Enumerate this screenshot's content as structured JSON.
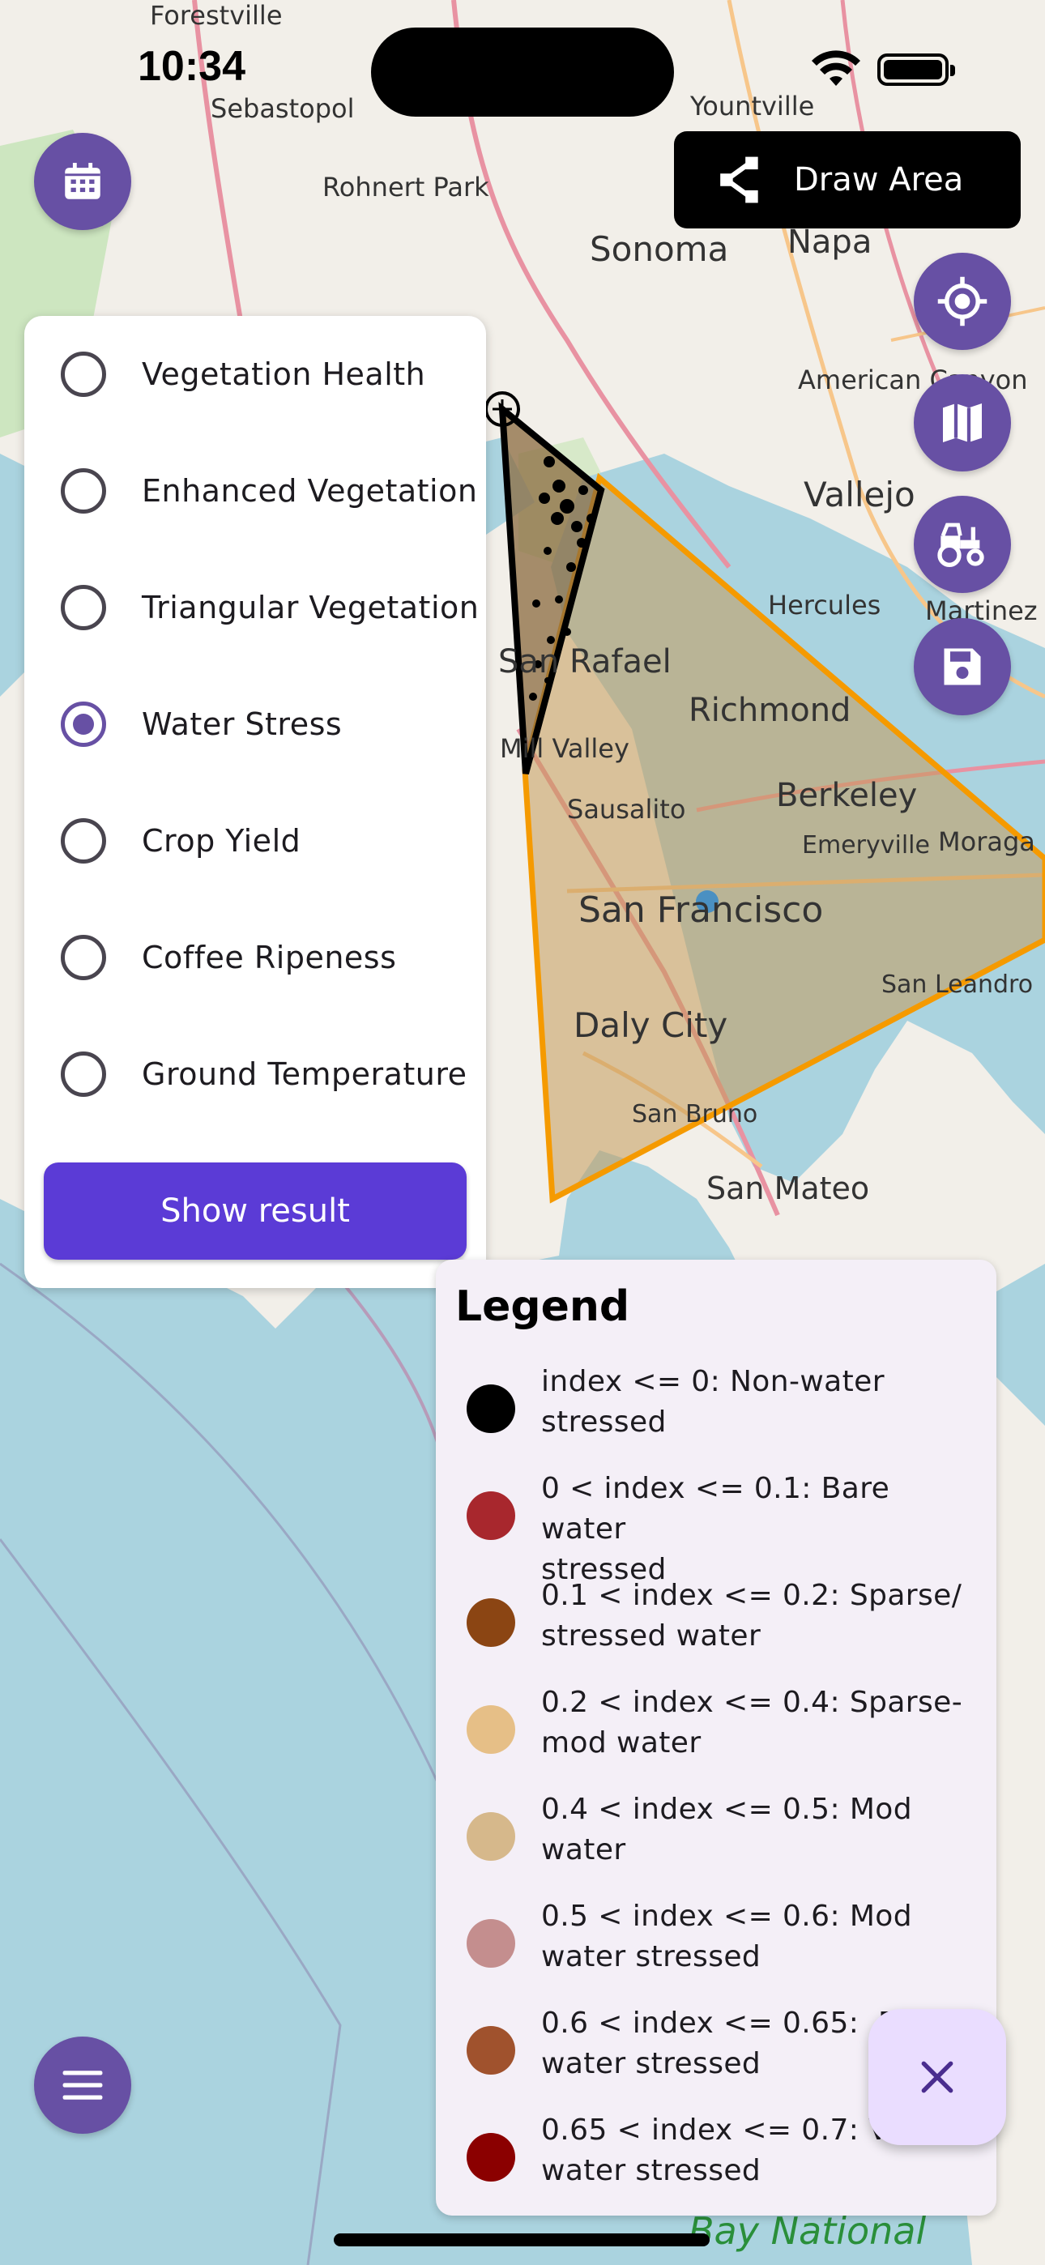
{
  "status_bar": {
    "time": "10:34"
  },
  "map": {
    "place_labels": [
      "Forestville",
      "Sebastopol",
      "Rohnert Park",
      "Sonoma",
      "Napa",
      "Yountville",
      "American Canyon",
      "Vallejo",
      "Hercules",
      "Martinez",
      "San Rafael",
      "Richmond",
      "Mill Valley",
      "Sausalito",
      "Berkeley",
      "Emeryville",
      "Moraga",
      "San Francisco",
      "San Leandro",
      "Daly City",
      "San Bruno",
      "San Mateo",
      "Bay National"
    ],
    "polygon_colors": {
      "black_area": "#000000",
      "orange_area": "#f59a00",
      "fill": "#a07d45"
    }
  },
  "toolbar": {
    "draw_area_label": "Draw Area",
    "calendar_icon": "calendar-icon",
    "locate_icon": "locate-icon",
    "map_icon": "map-icon",
    "tractor_icon": "tractor-icon",
    "save_icon": "save-icon",
    "menu_icon": "menu-icon"
  },
  "index_panel": {
    "options": [
      {
        "label": "Vegetation Health",
        "selected": false
      },
      {
        "label": "Enhanced Vegetation",
        "selected": false
      },
      {
        "label": "Triangular Vegetation",
        "selected": false
      },
      {
        "label": "Water Stress",
        "selected": true
      },
      {
        "label": "Crop Yield",
        "selected": false
      },
      {
        "label": "Coffee Ripeness",
        "selected": false
      },
      {
        "label": "Ground Temperature",
        "selected": false
      }
    ],
    "show_result_label": "Show result"
  },
  "legend": {
    "title": "Legend",
    "items": [
      {
        "color": "#000000",
        "text": "index <= 0: Non-water\nstressed"
      },
      {
        "color": "#a8272d",
        "text": "0 < index <= 0.1: Bare water\nstressed"
      },
      {
        "color": "#8b4513",
        "text": "0.1 < index <= 0.2: Sparse/\nstressed water"
      },
      {
        "color": "#e6bf87",
        "text": "0.2 < index <= 0.4: Sparse-\nmod water"
      },
      {
        "color": "#d6b88b",
        "text": "0.4 < index <= 0.5: Mod\nwater"
      },
      {
        "color": "#c48e8e",
        "text": "0.5 < index <= 0.6: Mod\nwater stressed"
      },
      {
        "color": "#a0522d",
        "text": "0.6 < index <= 0.65:  Der\nwater stressed"
      },
      {
        "color": "#8b0000",
        "text": "0.65 < index <= 0.7: Ver\nwater stressed"
      }
    ]
  }
}
